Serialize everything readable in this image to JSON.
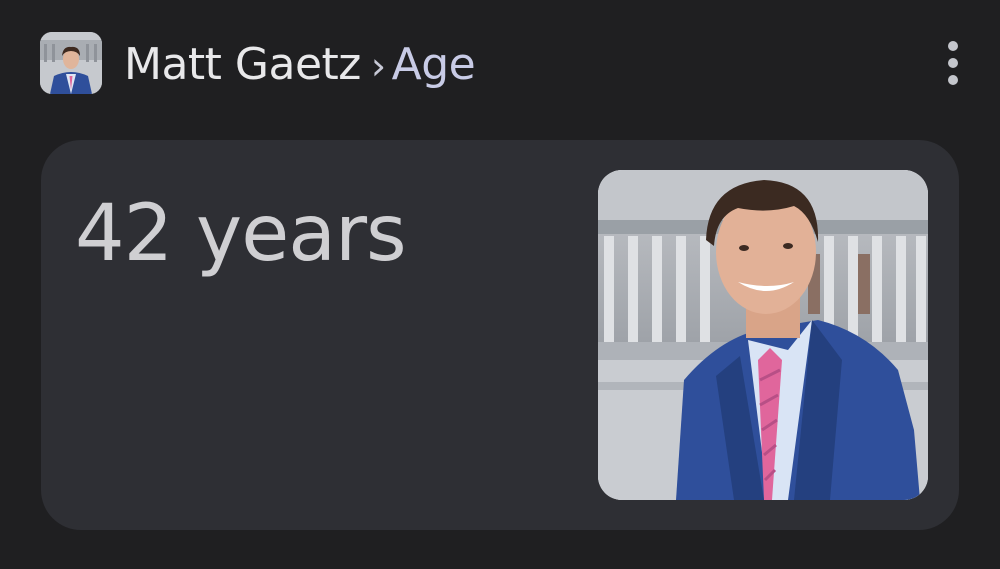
{
  "header": {
    "entity": "Matt Gaetz",
    "separator": "›",
    "attribute": "Age",
    "avatar_icon": "person-thumbnail",
    "more_icon": "more-vert-icon"
  },
  "answer_card": {
    "value": "42 years",
    "image_icon": "portrait-photo"
  },
  "colors": {
    "background": "#1f1f21",
    "card": "#2e2f34",
    "entity_text": "#e8e8ea",
    "attribute_text": "#c8cbe6",
    "answer_text": "#cfcfd2",
    "suit": "#2f4f9b",
    "tie": "#e0669c"
  }
}
